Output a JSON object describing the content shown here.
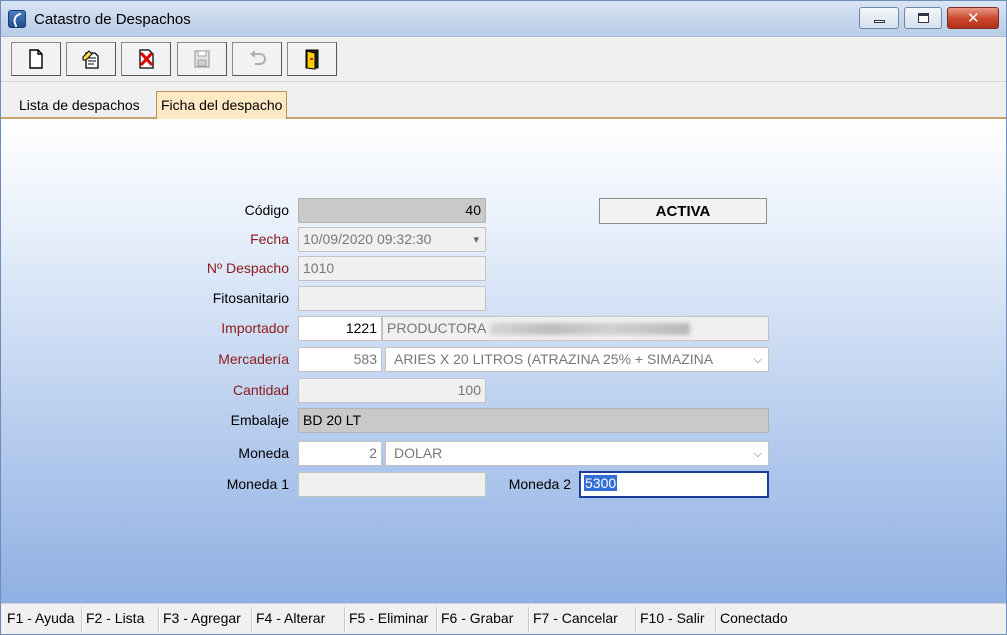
{
  "window": {
    "title": "Catastro de Despachos"
  },
  "toolbar": {
    "buttons": [
      {
        "name": "new-document-icon",
        "enabled": true
      },
      {
        "name": "edit-document-icon",
        "enabled": true
      },
      {
        "name": "delete-icon",
        "enabled": true
      },
      {
        "name": "save-icon",
        "enabled": false
      },
      {
        "name": "undo-icon",
        "enabled": false
      },
      {
        "name": "exit-door-icon",
        "enabled": true
      }
    ]
  },
  "tabs": [
    {
      "label": "Lista de despachos",
      "active": false
    },
    {
      "label": "Ficha del despacho",
      "active": true
    }
  ],
  "status_badge": "ACTIVA",
  "form": {
    "codigo": {
      "label": "Código",
      "value": "40"
    },
    "fecha": {
      "label": "Fecha",
      "value": "10/09/2020 09:32:30"
    },
    "despacho": {
      "label": "Nº Despacho",
      "value": "1010"
    },
    "fitosanitario": {
      "label": "Fitosanitario",
      "value": ""
    },
    "importador": {
      "label": "Importador",
      "code": "1221",
      "name": "PRODUCTORA"
    },
    "mercaderia": {
      "label": "Mercadería",
      "code": "583",
      "name": "ARIES X 20  LITROS (ATRAZINA 25% + SIMAZINA"
    },
    "cantidad": {
      "label": "Cantidad",
      "value": "100"
    },
    "embalaje": {
      "label": "Embalaje",
      "value": "BD 20 LT"
    },
    "moneda": {
      "label": "Moneda",
      "code": "2",
      "name": "DOLAR"
    },
    "moneda1": {
      "label": "Moneda 1",
      "value": ""
    },
    "moneda2": {
      "label": "Moneda 2",
      "value": "5300"
    }
  },
  "statusbar": [
    "F1 - Ayuda",
    "F2 - Lista",
    "F3 - Agregar",
    "F4 - Alterar",
    "F5 - Eliminar",
    "F6 - Grabar",
    "F7 - Cancelar",
    "F10 - Salir",
    "Conectado"
  ],
  "colors": {
    "required_label": "#8b1a1a",
    "active_tab": "#fde9c3",
    "focus_border": "#1e3c9a"
  }
}
